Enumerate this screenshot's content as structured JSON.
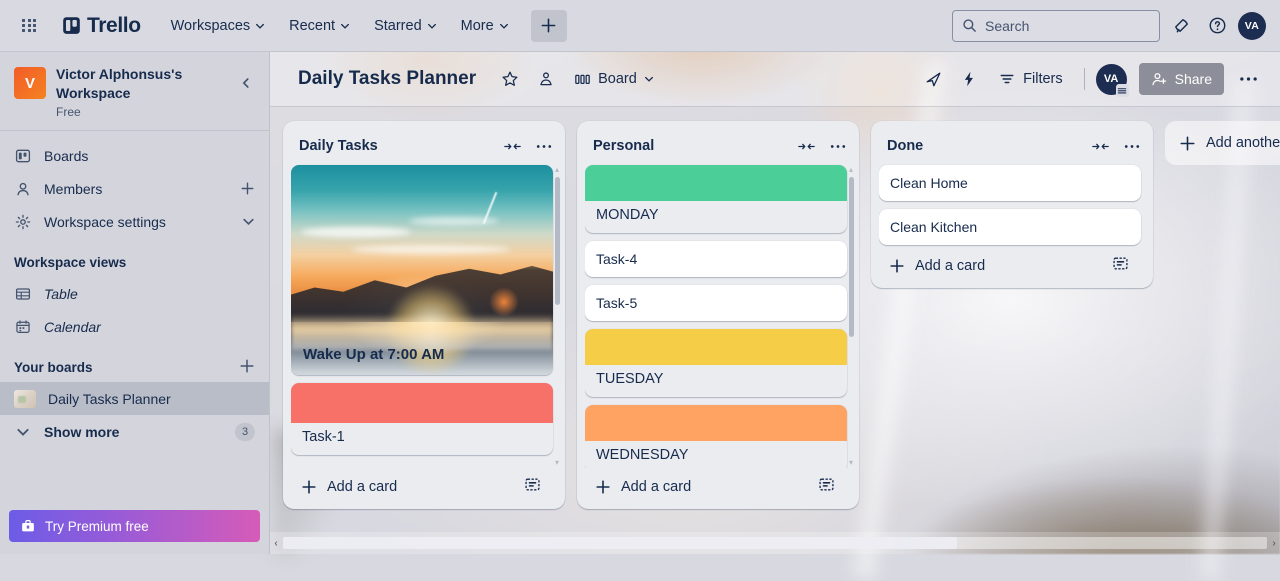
{
  "topnav": {
    "apps_icon": "apps-grid-icon",
    "brand": "Trello",
    "items": [
      {
        "label": "Workspaces",
        "icon": "chevron-down-icon"
      },
      {
        "label": "Recent",
        "icon": "chevron-down-icon"
      },
      {
        "label": "Starred",
        "icon": "chevron-down-icon"
      },
      {
        "label": "More",
        "icon": "chevron-down-icon"
      }
    ],
    "create_label": "+",
    "search": {
      "placeholder": "Search",
      "icon": "search-icon"
    },
    "notifications_icon": "notification-bell-icon",
    "help_icon": "help-circle-icon",
    "avatar": "VA"
  },
  "sidebar": {
    "workspace": {
      "initial": "V",
      "name": "Victor Alphonsus's Workspace",
      "plan": "Free",
      "collapse_icon": "chevron-left-icon"
    },
    "nav": [
      {
        "label": "Boards",
        "icon": "board-icon",
        "trailing": ""
      },
      {
        "label": "Members",
        "icon": "person-icon",
        "trailing": "+"
      },
      {
        "label": "Workspace settings",
        "icon": "gear-icon",
        "trailing": "chevron-down-icon"
      }
    ],
    "views_header": "Workspace views",
    "views": [
      {
        "label": "Table",
        "icon": "table-icon"
      },
      {
        "label": "Calendar",
        "icon": "calendar-icon"
      }
    ],
    "boards_header": "Your boards",
    "boards_add": "+",
    "boards": [
      {
        "label": "Daily Tasks Planner",
        "active": true
      }
    ],
    "show_more": {
      "label": "Show more",
      "count": "3",
      "icon": "chevron-down-icon"
    },
    "premium": {
      "label": "Try Premium free",
      "icon": "briefcase-icon"
    }
  },
  "board_header": {
    "title": "Daily Tasks Planner",
    "star_icon": "star-icon",
    "visibility_icon": "workspace-visible-icon",
    "view_icon": "board-view-icon",
    "view_label": "Board",
    "view_chevron": "chevron-down-icon",
    "rocket_icon": "rocket-icon",
    "automation_icon": "lightning-bolt-icon",
    "filters_icon": "filter-icon",
    "filters_label": "Filters",
    "avatar": "VA",
    "share_icon": "person-add-icon",
    "share_label": "Share",
    "more_icon": "ellipsis-icon"
  },
  "lists": [
    {
      "title": "Daily Tasks",
      "collapse_icon": "collapse-horizontal-icon",
      "more_icon": "ellipsis-icon",
      "cards": [
        {
          "type": "cover",
          "text": "Wake Up at 7:00 AM",
          "cover": "sunrise-photo"
        },
        {
          "type": "color",
          "text": "Task-1",
          "color": "#f87168"
        }
      ],
      "add_card": {
        "label": "Add a card",
        "plus": "+",
        "template_icon": "card-template-icon"
      }
    },
    {
      "title": "Personal",
      "collapse_icon": "collapse-horizontal-icon",
      "more_icon": "ellipsis-icon",
      "cards": [
        {
          "type": "color",
          "text": "MONDAY",
          "color": "#4bce97"
        },
        {
          "type": "plain",
          "text": "Task-4"
        },
        {
          "type": "plain",
          "text": "Task-5"
        },
        {
          "type": "color",
          "text": "TUESDAY",
          "color": "#f5cd47"
        },
        {
          "type": "color",
          "text": "WEDNESDAY",
          "color": "#fea362"
        },
        {
          "type": "plain",
          "text": ""
        }
      ],
      "add_card": {
        "label": "Add a card",
        "plus": "+",
        "template_icon": "card-template-icon"
      }
    },
    {
      "title": "Done",
      "collapse_icon": "collapse-horizontal-icon",
      "more_icon": "ellipsis-icon",
      "cards": [
        {
          "type": "plain",
          "text": "Clean Home"
        },
        {
          "type": "plain",
          "text": "Clean Kitchen"
        }
      ],
      "add_card": {
        "label": "Add a card",
        "plus": "+",
        "template_icon": "card-template-icon"
      }
    }
  ],
  "add_list": {
    "label": "Add another",
    "plus": "+"
  },
  "hscroll": {
    "left_arrow": "‹",
    "right_arrow": "›"
  },
  "colors": {
    "nav_bg": "#d9dae1",
    "sidebar_bg": "#d4d5dc",
    "list_bg": "#ebecf0",
    "text_primary": "#172b4d",
    "text_subtle": "#44546f",
    "share_btn": "#8c8f99",
    "green": "#4bce97",
    "yellow": "#f5cd47",
    "orange": "#fea362",
    "red": "#f87168"
  }
}
